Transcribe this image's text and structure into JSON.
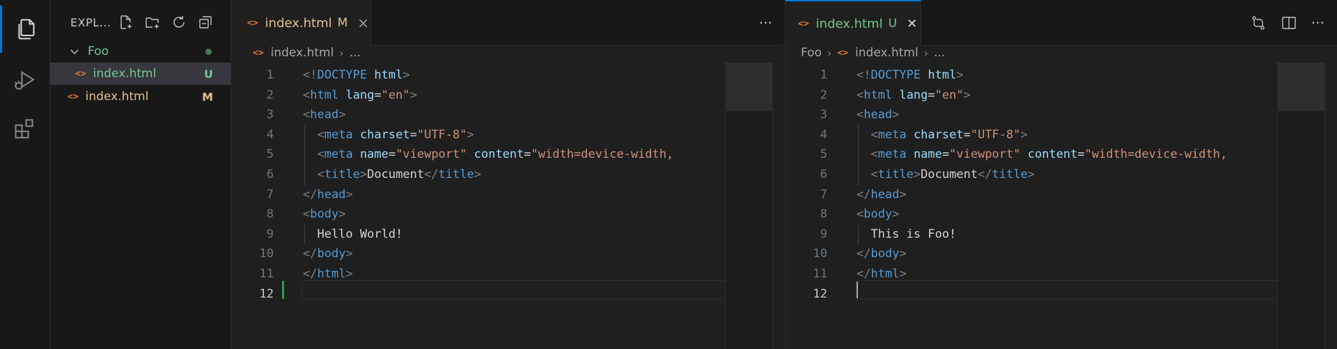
{
  "colors": {
    "accent": "#0078d4",
    "untracked": "#73c991",
    "modified": "#e2c08d",
    "file_icon": "#e37933"
  },
  "activity_bar": {
    "items": [
      "explorer-icon",
      "run-debug-icon",
      "extensions-icon"
    ]
  },
  "explorer": {
    "title": "EXPL...",
    "actions": [
      "new-file-icon",
      "new-folder-icon",
      "refresh-icon",
      "collapse-all-icon"
    ],
    "tree": [
      {
        "label": "Foo",
        "type": "folder",
        "badge": ""
      },
      {
        "label": "index.html",
        "type": "file",
        "badge": "U"
      },
      {
        "label": "index.html",
        "type": "file",
        "badge": "M"
      }
    ]
  },
  "editor_left": {
    "tab_label": "index.html",
    "tab_badge": "M",
    "tab_close": "×",
    "more": "···",
    "breadcrumb": [
      "index.html",
      "..."
    ],
    "lines": [
      [
        [
          "punc",
          "<!"
        ],
        [
          "kw",
          "DOCTYPE"
        ],
        [
          "txt",
          " "
        ],
        [
          "attr",
          "html"
        ],
        [
          "punc",
          ">"
        ]
      ],
      [
        [
          "punc",
          "<"
        ],
        [
          "tag",
          "html"
        ],
        [
          "txt",
          " "
        ],
        [
          "attr",
          "lang"
        ],
        [
          "txt",
          "="
        ],
        [
          "str",
          "\"en\""
        ],
        [
          "punc",
          ">"
        ]
      ],
      [
        [
          "punc",
          "<"
        ],
        [
          "tag",
          "head"
        ],
        [
          "punc",
          ">"
        ]
      ],
      [
        [
          "txt",
          "  "
        ],
        [
          "punc",
          "<"
        ],
        [
          "tag",
          "meta"
        ],
        [
          "txt",
          " "
        ],
        [
          "attr",
          "charset"
        ],
        [
          "txt",
          "="
        ],
        [
          "str",
          "\"UTF-8\""
        ],
        [
          "punc",
          ">"
        ]
      ],
      [
        [
          "txt",
          "  "
        ],
        [
          "punc",
          "<"
        ],
        [
          "tag",
          "meta"
        ],
        [
          "txt",
          " "
        ],
        [
          "attr",
          "name"
        ],
        [
          "txt",
          "="
        ],
        [
          "str",
          "\"viewport\""
        ],
        [
          "txt",
          " "
        ],
        [
          "attr",
          "content"
        ],
        [
          "txt",
          "="
        ],
        [
          "str",
          "\"width=device-width,"
        ]
      ],
      [
        [
          "txt",
          "  "
        ],
        [
          "punc",
          "<"
        ],
        [
          "tag",
          "title"
        ],
        [
          "punc",
          ">"
        ],
        [
          "txt",
          "Document"
        ],
        [
          "punc",
          "</"
        ],
        [
          "tag",
          "title"
        ],
        [
          "punc",
          ">"
        ]
      ],
      [
        [
          "punc",
          "</"
        ],
        [
          "tag",
          "head"
        ],
        [
          "punc",
          ">"
        ]
      ],
      [
        [
          "punc",
          "<"
        ],
        [
          "tag",
          "body"
        ],
        [
          "punc",
          ">"
        ]
      ],
      [
        [
          "txt",
          "  Hello World!"
        ]
      ],
      [
        [
          "punc",
          "</"
        ],
        [
          "tag",
          "body"
        ],
        [
          "punc",
          ">"
        ]
      ],
      [
        [
          "punc",
          "</"
        ],
        [
          "tag",
          "html"
        ],
        [
          "punc",
          ">"
        ]
      ],
      []
    ],
    "line_numbers": [
      "1",
      "2",
      "3",
      "4",
      "5",
      "6",
      "7",
      "8",
      "9",
      "10",
      "11",
      "12"
    ]
  },
  "editor_right": {
    "tab_label": "index.html",
    "tab_badge": "U",
    "tab_close": "✕",
    "more": "···",
    "breadcrumb": [
      "Foo",
      "index.html",
      "..."
    ],
    "lines": [
      [
        [
          "punc",
          "<!"
        ],
        [
          "kw",
          "DOCTYPE"
        ],
        [
          "txt",
          " "
        ],
        [
          "attr",
          "html"
        ],
        [
          "punc",
          ">"
        ]
      ],
      [
        [
          "punc",
          "<"
        ],
        [
          "tag",
          "html"
        ],
        [
          "txt",
          " "
        ],
        [
          "attr",
          "lang"
        ],
        [
          "txt",
          "="
        ],
        [
          "str",
          "\"en\""
        ],
        [
          "punc",
          ">"
        ]
      ],
      [
        [
          "punc",
          "<"
        ],
        [
          "tag",
          "head"
        ],
        [
          "punc",
          ">"
        ]
      ],
      [
        [
          "txt",
          "  "
        ],
        [
          "punc",
          "<"
        ],
        [
          "tag",
          "meta"
        ],
        [
          "txt",
          " "
        ],
        [
          "attr",
          "charset"
        ],
        [
          "txt",
          "="
        ],
        [
          "str",
          "\"UTF-8\""
        ],
        [
          "punc",
          ">"
        ]
      ],
      [
        [
          "txt",
          "  "
        ],
        [
          "punc",
          "<"
        ],
        [
          "tag",
          "meta"
        ],
        [
          "txt",
          " "
        ],
        [
          "attr",
          "name"
        ],
        [
          "txt",
          "="
        ],
        [
          "str",
          "\"viewport\""
        ],
        [
          "txt",
          " "
        ],
        [
          "attr",
          "content"
        ],
        [
          "txt",
          "="
        ],
        [
          "str",
          "\"width=device-width,"
        ]
      ],
      [
        [
          "txt",
          "  "
        ],
        [
          "punc",
          "<"
        ],
        [
          "tag",
          "title"
        ],
        [
          "punc",
          ">"
        ],
        [
          "txt",
          "Document"
        ],
        [
          "punc",
          "</"
        ],
        [
          "tag",
          "title"
        ],
        [
          "punc",
          ">"
        ]
      ],
      [
        [
          "punc",
          "</"
        ],
        [
          "tag",
          "head"
        ],
        [
          "punc",
          ">"
        ]
      ],
      [
        [
          "punc",
          "<"
        ],
        [
          "tag",
          "body"
        ],
        [
          "punc",
          ">"
        ]
      ],
      [
        [
          "txt",
          "  This is Foo!"
        ]
      ],
      [
        [
          "punc",
          "</"
        ],
        [
          "tag",
          "body"
        ],
        [
          "punc",
          ">"
        ]
      ],
      [
        [
          "punc",
          "</"
        ],
        [
          "tag",
          "html"
        ],
        [
          "punc",
          ">"
        ]
      ],
      []
    ],
    "line_numbers": [
      "1",
      "2",
      "3",
      "4",
      "5",
      "6",
      "7",
      "8",
      "9",
      "10",
      "11",
      "12"
    ]
  }
}
